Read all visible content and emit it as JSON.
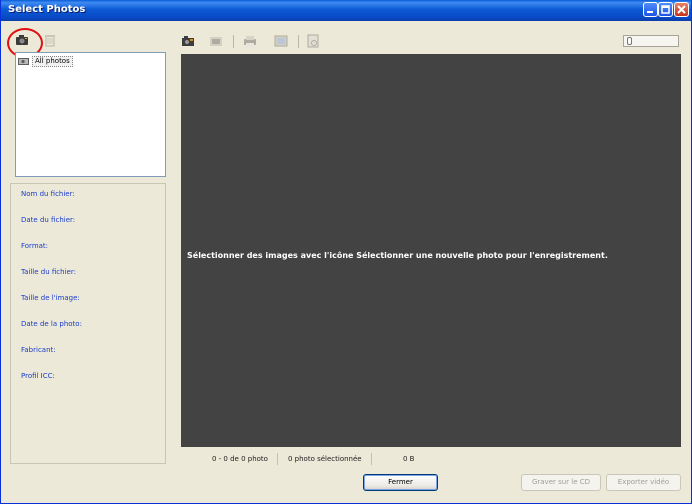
{
  "window": {
    "title": "Select Photos"
  },
  "tree": {
    "root_label": "All photos"
  },
  "info": {
    "labels": [
      "Nom du fichier:",
      "Date du fichier:",
      "Format:",
      "Taille du fichier:",
      "Taille de l'image:",
      "Date de la photo:",
      "Fabricant:",
      "Profil ICC:"
    ]
  },
  "preview": {
    "message": "Sélectionner des images avec l'icône Sélectionner une nouvelle photo pour l'enregistrement."
  },
  "status": {
    "count": "0 - 0 de 0 photo",
    "selected": "0 photo sélectionnée",
    "size": "0 B"
  },
  "buttons": {
    "close": "Fermer",
    "burn_cd": "Graver sur le CD",
    "export_video": "Exporter vidéo"
  },
  "icons": {
    "highlight_color": "#e01010",
    "titlebar_color": "#0a5cd8"
  }
}
